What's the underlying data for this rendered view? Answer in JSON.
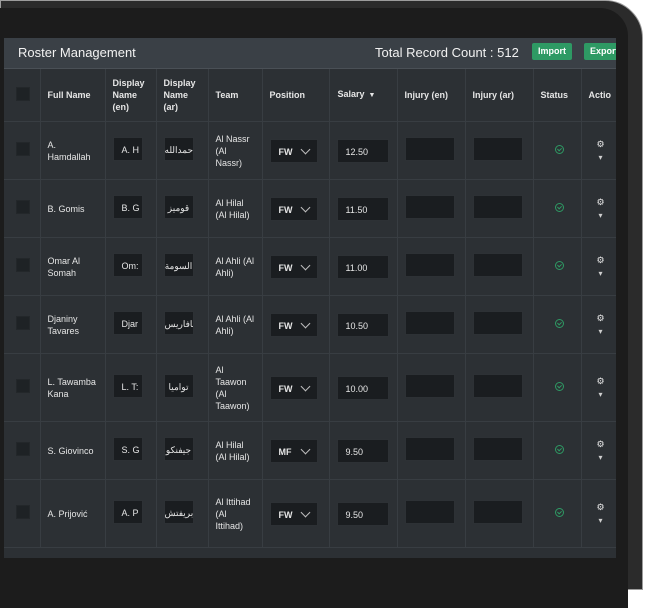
{
  "header": {
    "title": "Roster Management",
    "total_record_count": "Total Record Count : 512",
    "import_label": "Import",
    "export_label": "Export"
  },
  "columns": {
    "full_name": "Full Name",
    "display_name_en": "Display Name (en)",
    "display_name_ar": "Display Name (ar)",
    "team": "Team",
    "position": "Position",
    "salary": "Salary",
    "injury_en": "Injury (en)",
    "injury_ar": "Injury (ar)",
    "status": "Status",
    "actions": "Actio"
  },
  "rows": [
    {
      "full_name": "A. Hamdallah",
      "display_en": "A. H",
      "display_ar": "حمدالله",
      "team": "Al Nassr (Al Nassr)",
      "position": "FW",
      "salary": "12.50"
    },
    {
      "full_name": "B. Gomis",
      "display_en": "B. G",
      "display_ar": "قوميز",
      "team": "Al Hilal (Al Hilal)",
      "position": "FW",
      "salary": "11.50"
    },
    {
      "full_name": "Omar Al Somah",
      "display_en": "Om:",
      "display_ar": "السومة",
      "team": "Al Ahli (Al Ahli)",
      "position": "FW",
      "salary": "11.00"
    },
    {
      "full_name": "Djaniny Tavares",
      "display_en": "Djar",
      "display_ar": "تافاريس",
      "team": "Al Ahli (Al Ahli)",
      "position": "FW",
      "salary": "10.50"
    },
    {
      "full_name": "L. Tawamba Kana",
      "display_en": "L. T:",
      "display_ar": "تواميا",
      "team": "Al Taawon (Al Taawon)",
      "position": "FW",
      "salary": "10.00"
    },
    {
      "full_name": "S. Giovinco",
      "display_en": "S. G",
      "display_ar": "جيفنكو",
      "team": "Al Hilal (Al Hilal)",
      "position": "MF",
      "salary": "9.50"
    },
    {
      "full_name": "A. Prijović",
      "display_en": "A. P",
      "display_ar": "بريفتش",
      "team": "Al Ittihad (Al Ittihad)",
      "position": "FW",
      "salary": "9.50"
    }
  ],
  "icons": {
    "status": "check-circle-icon",
    "action": "cogs-icon",
    "sort": "caret-down-icon"
  },
  "colors": {
    "accent_green": "#2e9a64",
    "background": "#2c3034"
  }
}
